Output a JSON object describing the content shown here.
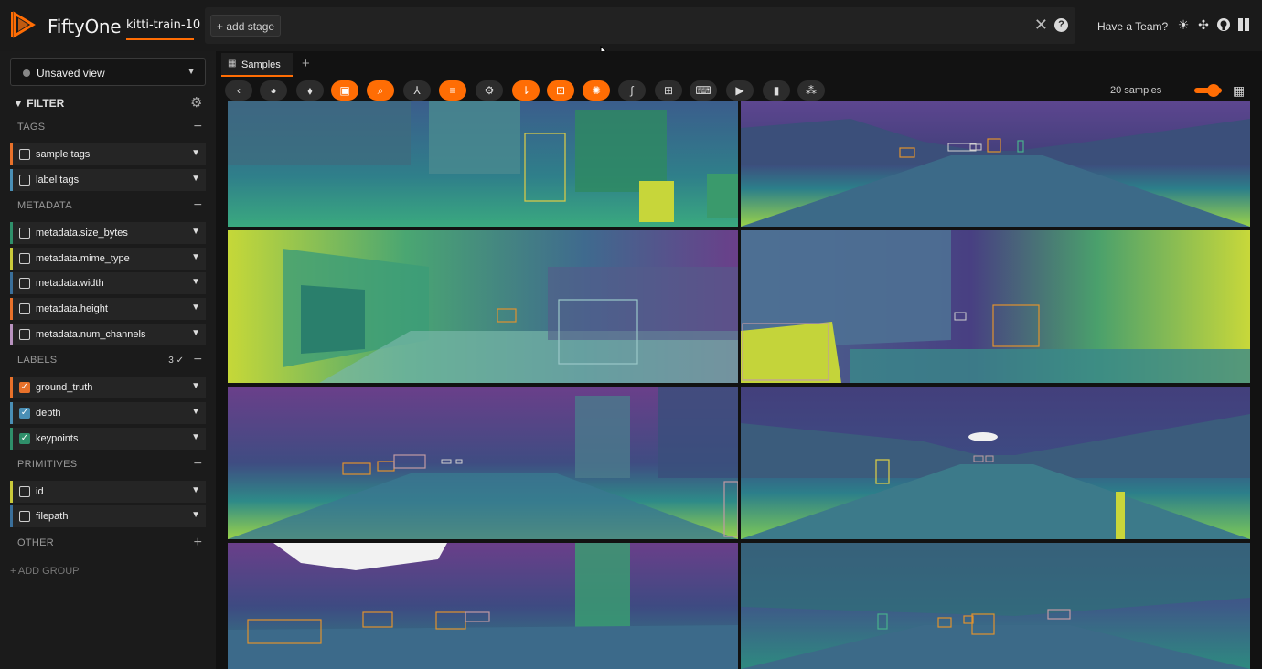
{
  "app": {
    "name": "FiftyOne",
    "dataset": "kitti-train-10"
  },
  "stages": {
    "add_label": "+ add stage",
    "clear_icon": "close-icon",
    "help_icon": "help-icon"
  },
  "header": {
    "team_label": "Have a Team?"
  },
  "colors": {
    "accent": "#ff6d04",
    "depth_low": "#472d7b",
    "depth_mid": "#21908c",
    "depth_high": "#fde725"
  },
  "sidebar": {
    "view_label": "Unsaved view",
    "filter_label": "FILTER",
    "groups": {
      "tags": {
        "label": "TAGS",
        "action": "−"
      },
      "metadata": {
        "label": "METADATA",
        "action": "−"
      },
      "labels": {
        "label": "LABELS",
        "count": "3 ✓",
        "action": "−"
      },
      "primitives": {
        "label": "PRIMITIVES",
        "action": "−"
      },
      "other": {
        "label": "OTHER",
        "action": "+"
      }
    },
    "fields": {
      "sample_tags": "sample tags",
      "label_tags": "label tags",
      "size_bytes": "metadata.size_bytes",
      "mime_type": "metadata.mime_type",
      "width": "metadata.width",
      "height": "metadata.height",
      "num_channels": "metadata.num_channels",
      "ground_truth": "ground_truth",
      "depth": "depth",
      "keypoints": "keypoints",
      "id": "id",
      "filepath": "filepath"
    },
    "add_group": "+ ADD GROUP"
  },
  "main": {
    "tab_label": "Samples",
    "tab_add": "+",
    "sample_count": "20 samples"
  }
}
